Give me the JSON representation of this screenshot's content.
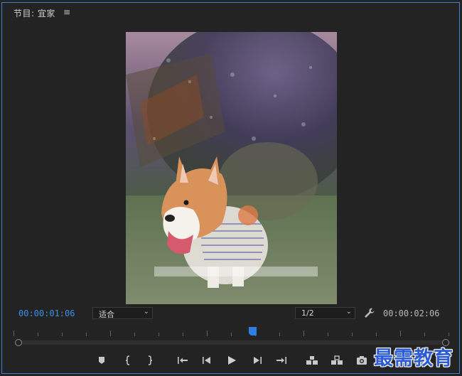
{
  "panel": {
    "title": "节目: 宜家",
    "menu_icon": "hamburger-icon",
    "menu_glyph": "≡"
  },
  "playback": {
    "current_time": "00:00:01:06",
    "total_time": "00:00:02:06",
    "fit_option": "适合",
    "resolution": "1/2"
  },
  "transport": {
    "buttons": [
      "add-marker-icon",
      "mark-in-icon",
      "mark-out-icon",
      "go-to-in-icon",
      "step-back-icon",
      "play-icon",
      "step-forward-icon",
      "go-to-out-icon",
      "lift-icon",
      "extract-icon",
      "export-frame-icon"
    ]
  },
  "colors": {
    "accent": "#3b8fe8",
    "panel_border": "#3f7fd0",
    "background": "#232323"
  },
  "watermark": {
    "text": "最需教育"
  }
}
